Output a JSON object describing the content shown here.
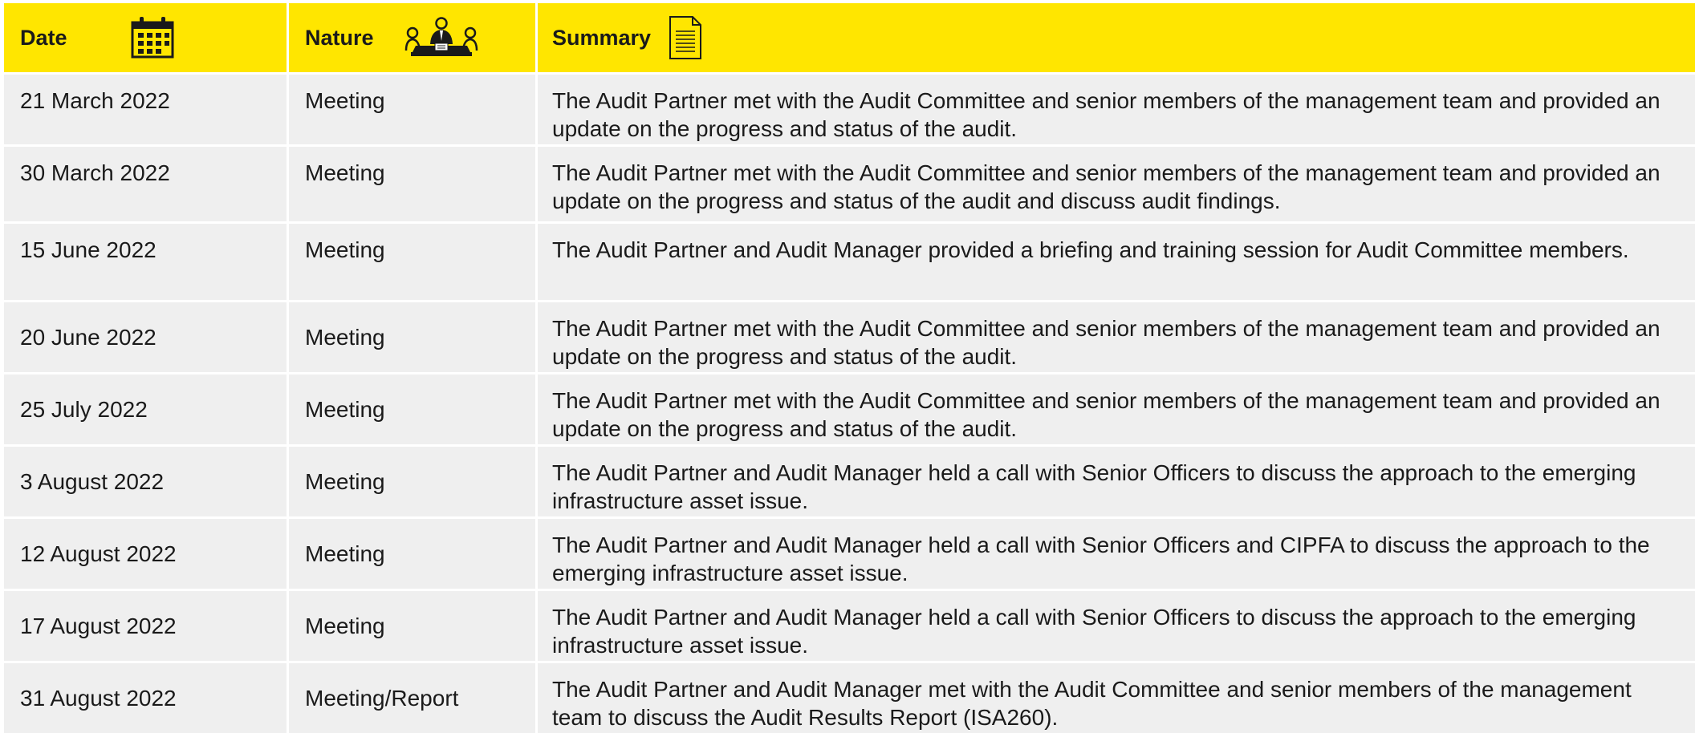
{
  "table": {
    "headers": {
      "date": "Date",
      "nature": "Nature",
      "summary": "Summary"
    },
    "header_icons": {
      "date": "calendar-icon",
      "nature": "meeting-icon",
      "summary": "document-icon"
    },
    "rows": [
      {
        "date": "21 March 2022",
        "nature": "Meeting",
        "summary": "The Audit Partner met with the Audit Committee and senior members of the management team and provided an update on the progress and status of the audit."
      },
      {
        "date": "30 March 2022",
        "nature": "Meeting",
        "summary": "The Audit Partner met with the Audit Committee and senior members of the management team and provided an update on the progress and status of the audit and discuss audit findings."
      },
      {
        "date": "15 June 2022",
        "nature": "Meeting",
        "summary": "The Audit Partner and Audit Manager provided a briefing and training session for Audit Committee members."
      },
      {
        "date": "20 June 2022",
        "nature": "Meeting",
        "summary": "The Audit Partner met with the Audit Committee and senior members of the management team and provided an update on the progress and status of the audit."
      },
      {
        "date": "25 July 2022",
        "nature": "Meeting",
        "summary": "The Audit Partner met with the Audit Committee and senior members of the management team and provided an update on the progress and status of the audit."
      },
      {
        "date": "3 August 2022",
        "nature": "Meeting",
        "summary": "The Audit Partner and Audit Manager held a call with Senior Officers to discuss the approach to the emerging infrastructure asset issue."
      },
      {
        "date": "12 August 2022",
        "nature": "Meeting",
        "summary": "The Audit Partner and Audit Manager held a call with Senior Officers and CIPFA to discuss the approach to the emerging infrastructure asset issue."
      },
      {
        "date": "17 August 2022",
        "nature": "Meeting",
        "summary": "The Audit Partner and Audit Manager held a call with Senior Officers to discuss the approach to the emerging infrastructure asset issue."
      },
      {
        "date": "31 August 2022",
        "nature": "Meeting/Report",
        "summary": "The Audit Partner and Audit Manager met with the Audit Committee and senior members of the management team to discuss the Audit Results Report (ISA260)."
      }
    ]
  },
  "colors": {
    "header_background": "#ffe600",
    "row_background": "#efefef",
    "divider": "#ffffff",
    "text": "#1a1a1a"
  }
}
